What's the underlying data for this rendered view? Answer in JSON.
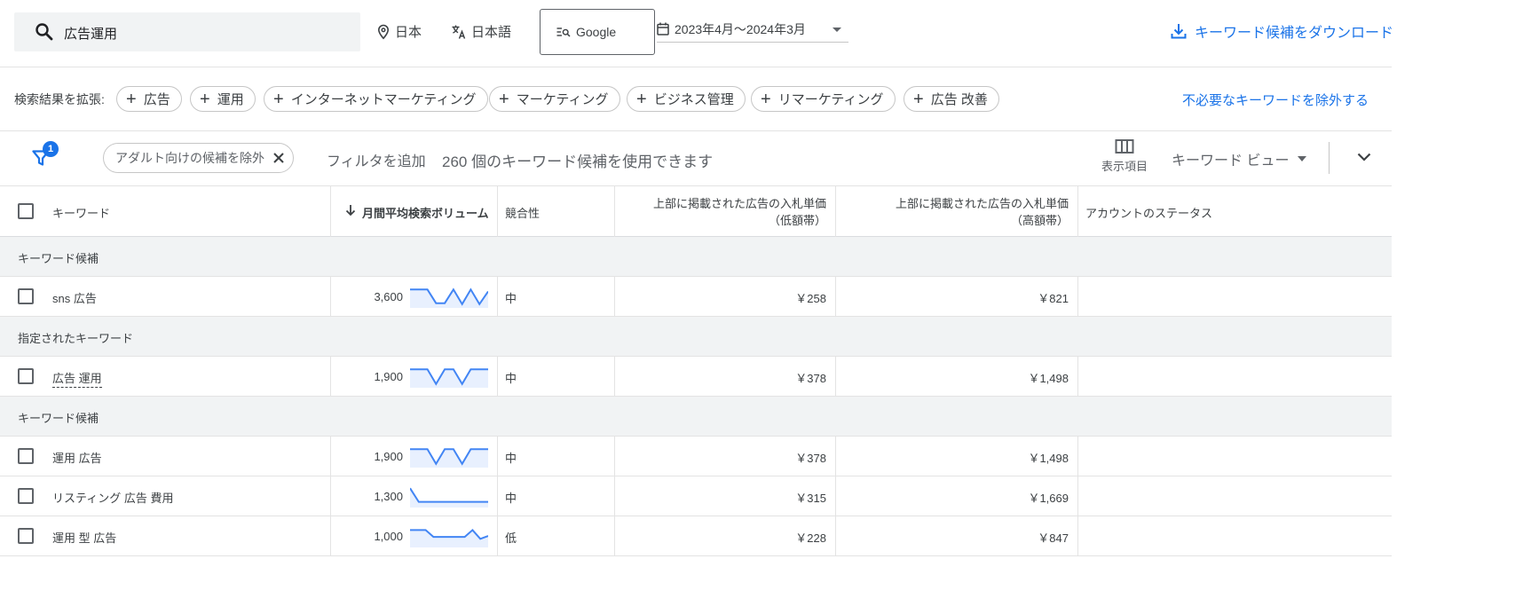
{
  "search": {
    "query": "広告運用"
  },
  "location": "日本",
  "language": "日本語",
  "engine": "Google",
  "date_range": "2023年4月〜2024年3月",
  "download_label": "キーワード候補をダウンロード",
  "expand": {
    "label": "検索結果を拡張:",
    "chips": [
      "広告",
      "運用",
      "インターネットマーケティング",
      "マーケティング",
      "ビジネス管理",
      "リマーケティング",
      "広告 改善"
    ],
    "exclude_link": "不必要なキーワードを除外する"
  },
  "filter": {
    "badge": "1",
    "chip_label": "アダルト向けの候補を除外",
    "add_filter": "フィルタを追加",
    "count_text": "260 個のキーワード候補を使用できます",
    "columns_label": "表示項目",
    "view_label": "キーワード ビュー"
  },
  "table": {
    "headers": {
      "keyword": "キーワード",
      "volume": "月間平均検索ボリューム",
      "competition": "競合性",
      "low_bid_1": "上部に掲載された広告の入札単価",
      "low_bid_2": "（低額帯）",
      "high_bid_1": "上部に掲載された広告の入札単価",
      "high_bid_2": "（高額帯）",
      "status": "アカウントのステータス"
    },
    "groups": [
      {
        "label": "キーワード候補"
      },
      {
        "label": "指定されたキーワード"
      },
      {
        "label": "キーワード候補"
      }
    ],
    "rows": [
      {
        "keyword": "sns 広告",
        "volume": "3,600",
        "competition": "中",
        "low_bid": "￥258",
        "high_bid": "￥821",
        "trend": [
          0.85,
          0.85,
          0.85,
          0.15,
          0.15,
          0.85,
          0.1,
          0.85,
          0.1,
          0.75
        ]
      },
      {
        "keyword": "広告 運用",
        "volume": "1,900",
        "competition": "中",
        "low_bid": "￥378",
        "high_bid": "￥1,498",
        "trend": [
          0.85,
          0.85,
          0.85,
          0.1,
          0.85,
          0.85,
          0.1,
          0.85,
          0.85,
          0.85
        ]
      },
      {
        "keyword": "運用 広告",
        "volume": "1,900",
        "competition": "中",
        "low_bid": "￥378",
        "high_bid": "￥1,498",
        "trend": [
          0.85,
          0.85,
          0.85,
          0.1,
          0.85,
          0.85,
          0.1,
          0.85,
          0.85,
          0.85
        ]
      },
      {
        "keyword": "リスティング 広告 費用",
        "volume": "1,300",
        "competition": "中",
        "low_bid": "￥315",
        "high_bid": "￥1,669",
        "trend": [
          0.9,
          0.2,
          0.2,
          0.2,
          0.2,
          0.2,
          0.2,
          0.2,
          0.2,
          0.2
        ]
      },
      {
        "keyword": "運用 型 広告",
        "volume": "1,000",
        "competition": "低",
        "low_bid": "￥228",
        "high_bid": "￥847",
        "trend": [
          0.8,
          0.8,
          0.8,
          0.45,
          0.45,
          0.45,
          0.45,
          0.45,
          0.8,
          0.35,
          0.5
        ]
      }
    ]
  },
  "colors": {
    "accent": "#1a73e8",
    "spark_line": "#4285f4",
    "spark_fill": "#e8f0fe",
    "group_bg": "#f1f3f4"
  }
}
